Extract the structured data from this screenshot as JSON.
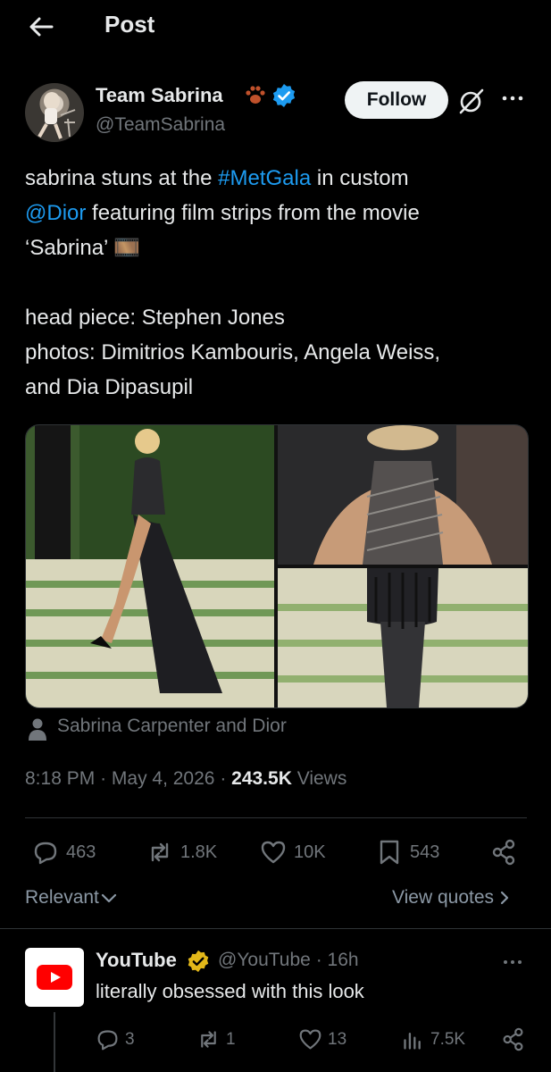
{
  "header": {
    "title": "Post"
  },
  "author": {
    "name": "Team Sabrina",
    "handle": "@TeamSabrina",
    "follow_label": "Follow"
  },
  "tweet": {
    "lines": [
      [
        {
          "t": "sabrina stuns at the "
        },
        {
          "t": "#MetGala",
          "link": true
        },
        {
          "t": " in custom"
        }
      ],
      [
        {
          "t": "@Dior",
          "link": true
        },
        {
          "t": " featuring film strips from the movie"
        }
      ],
      [
        {
          "t": "‘Sabrina’ 🎞️"
        }
      ],
      [
        {
          "t": ""
        }
      ],
      [
        {
          "t": "head piece: Stephen Jones"
        }
      ],
      [
        {
          "t": "photos: Dimitrios Kambouris, Angela Weiss,"
        }
      ],
      [
        {
          "t": "and Dia Dipasupil"
        }
      ]
    ]
  },
  "media": {
    "tag": "Sabrina Carpenter and Dior"
  },
  "meta": {
    "time": "8:18 PM",
    "date": "May 4, 2026",
    "views_count": "243.5K",
    "views_label": "Views"
  },
  "actions": {
    "replies": "463",
    "reposts": "1.8K",
    "likes": "10K",
    "bookmarks": "543"
  },
  "sort": {
    "relevant_label": "Relevant",
    "view_quotes_label": "View quotes"
  },
  "reply": {
    "name": "YouTube",
    "handle": "@YouTube",
    "time": "16h",
    "text": "literally obsessed with this look",
    "replies": "3",
    "reposts": "1",
    "likes": "13",
    "views": "7.5K"
  },
  "colors": {
    "background": "#000000",
    "text": "#e7e9ea",
    "muted": "#71767b",
    "link": "#1d9bf0",
    "verified_blue": "#1d9bf0",
    "verified_gold": "#e2b719",
    "youtube_red": "#ff0000"
  },
  "icons": [
    "back-arrow-icon",
    "paw-icon",
    "verified-badge-icon",
    "grok-icon",
    "more-icon",
    "person-tag-icon",
    "reply-icon",
    "repost-icon",
    "like-icon",
    "bookmark-icon",
    "share-icon",
    "chevron-down-icon",
    "chevron-right-icon",
    "youtube-logo-icon",
    "gold-verified-icon",
    "views-icon"
  ]
}
